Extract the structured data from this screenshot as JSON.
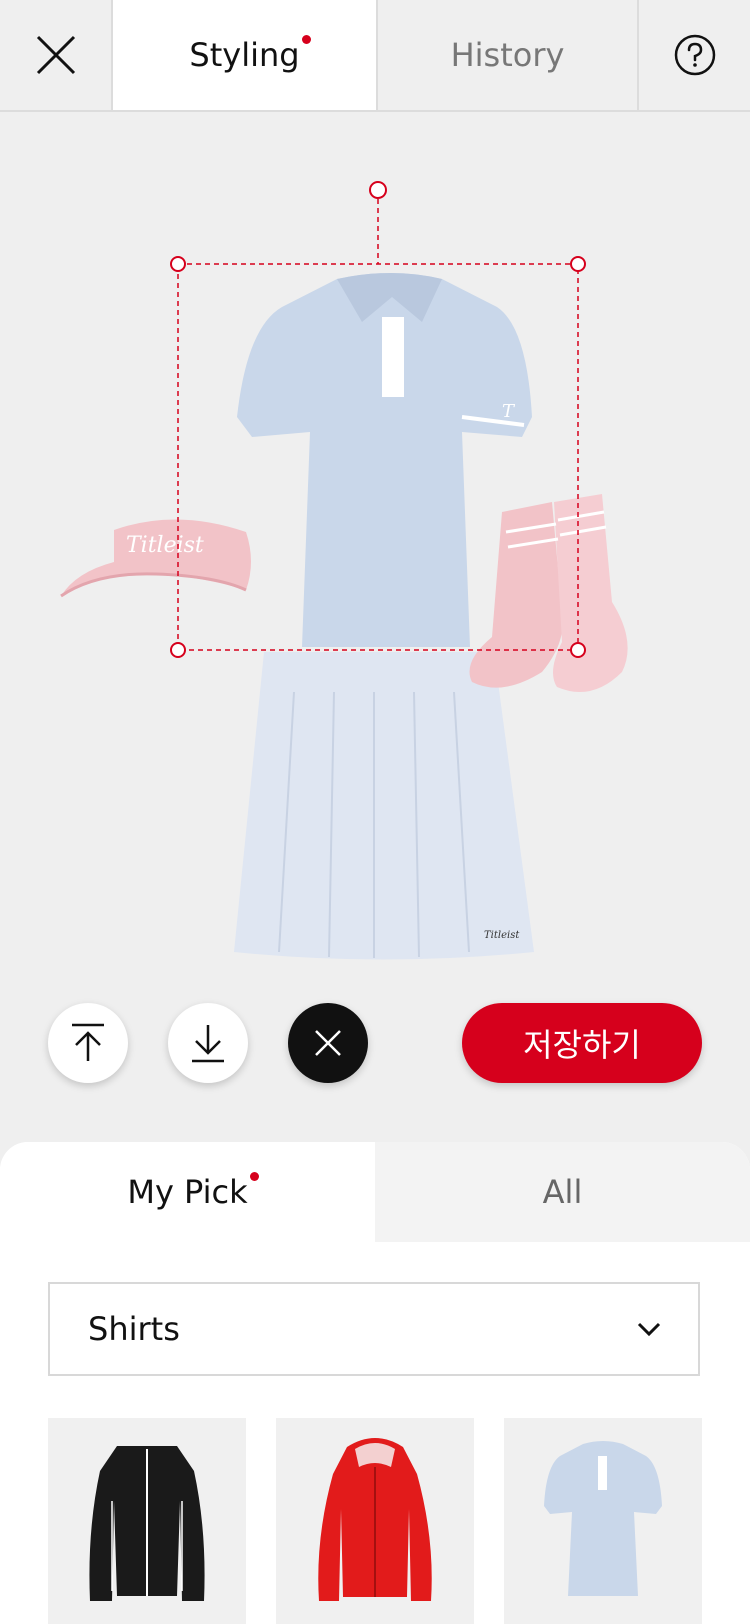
{
  "header": {
    "close_icon": "close-icon",
    "tabs": [
      {
        "label": "Styling",
        "active": true,
        "has_dot": true
      },
      {
        "label": "History",
        "active": false,
        "has_dot": false
      }
    ],
    "help_icon": "help-icon"
  },
  "actions": {
    "bring_front_icon": "bring-to-front-icon",
    "send_back_icon": "send-to-back-icon",
    "remove_icon": "remove-icon",
    "save_label": "저장하기"
  },
  "sheet": {
    "tabs": [
      {
        "label": "My Pick",
        "active": true,
        "has_dot": true
      },
      {
        "label": "All",
        "active": false
      }
    ],
    "category": "Shirts",
    "products": [
      {
        "name": "black jacket"
      },
      {
        "name": "red hooded jacket"
      },
      {
        "name": "light blue polo shirt"
      }
    ]
  },
  "colors": {
    "accent": "#d6001c",
    "shirt": "#c9d7ea",
    "skirt": "#dfe6f2",
    "pink": "#f2c3c8"
  }
}
